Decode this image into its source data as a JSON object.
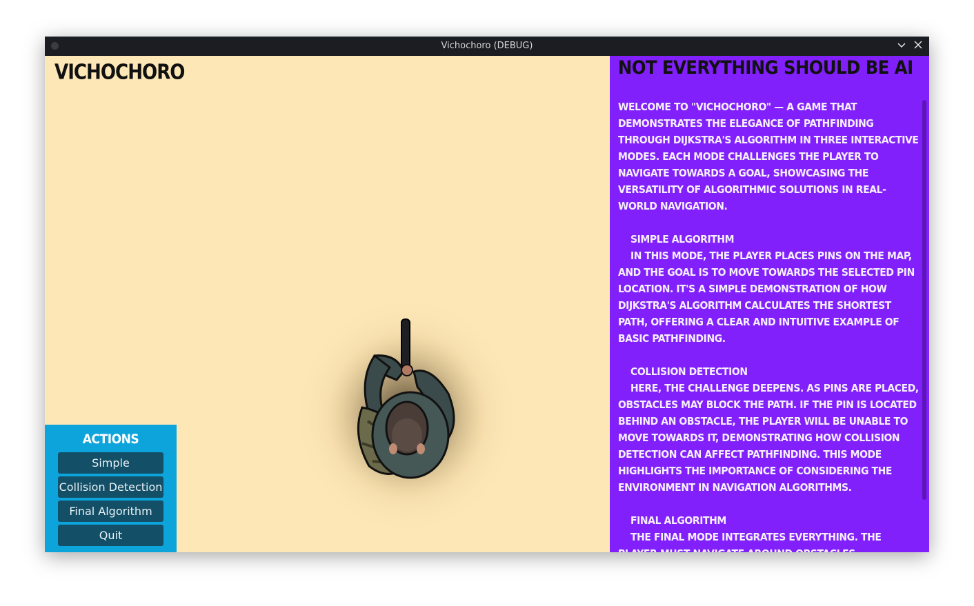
{
  "window": {
    "title": "Vichochoro (DEBUG)"
  },
  "game": {
    "title": "VICHOCHORO"
  },
  "actions": {
    "title": "ACTIONS",
    "buttons": {
      "simple": "Simple",
      "collision": "Collision Detection",
      "final": "Final Algorithm",
      "quit": "Quit"
    }
  },
  "panel": {
    "title": "Not everything should be AI",
    "intro": "Welcome to \"Vichochoro\" — a game that demonstrates the elegance of pathfinding through Dijkstra's algorithm in three interactive modes. Each mode challenges the player to navigate towards a goal, showcasing the versatility of algorithmic solutions in real-world navigation.",
    "sections": [
      {
        "heading": "Simple Algorithm",
        "body": "In this mode, the player places pins on the map, and the goal is to move towards the selected pin location. It's a simple demonstration of how Dijkstra's algorithm calculates the shortest path, offering a clear and intuitive example of basic pathfinding."
      },
      {
        "heading": "Collision Detection",
        "body": "Here, the challenge deepens. As pins are placed, obstacles may block the path. If the pin is located behind an obstacle, the player will be unable to move towards it, demonstrating how collision detection can affect pathfinding. This mode highlights the importance of considering the environment in navigation algorithms."
      },
      {
        "heading": "Final Algorithm",
        "body": "The final mode integrates everything. The player must navigate around obstacles, searching for the shortest path to reach the target pin, all while considering real-time collisions. This is where"
      }
    ]
  },
  "icons": {
    "minimize": "chevron-down-icon",
    "close": "close-icon"
  }
}
